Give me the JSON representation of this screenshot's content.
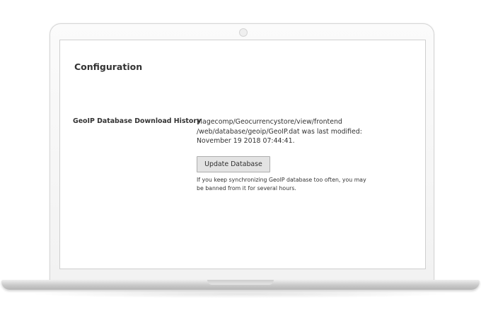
{
  "config": {
    "section_title": "Configuration",
    "geoip": {
      "label": "GeoIP Database Download History",
      "path_lines": [
        "Magecomp/Geocurrencystore/view/frontend",
        "/web/database/geoip/GeoIP.dat was last modified:",
        "November 19 2018 07:44:41."
      ],
      "button_label": "Update Database",
      "note_lines": [
        "If you keep synchronizing GeoIP database too often, you may",
        "be banned from it for several hours."
      ]
    }
  },
  "colors": {
    "text": "#333333",
    "button_bg": "#e3e3e3",
    "button_border": "#adadad",
    "screen_bg": "#ffffff",
    "laptop_frame": "#f5f5f5"
  }
}
